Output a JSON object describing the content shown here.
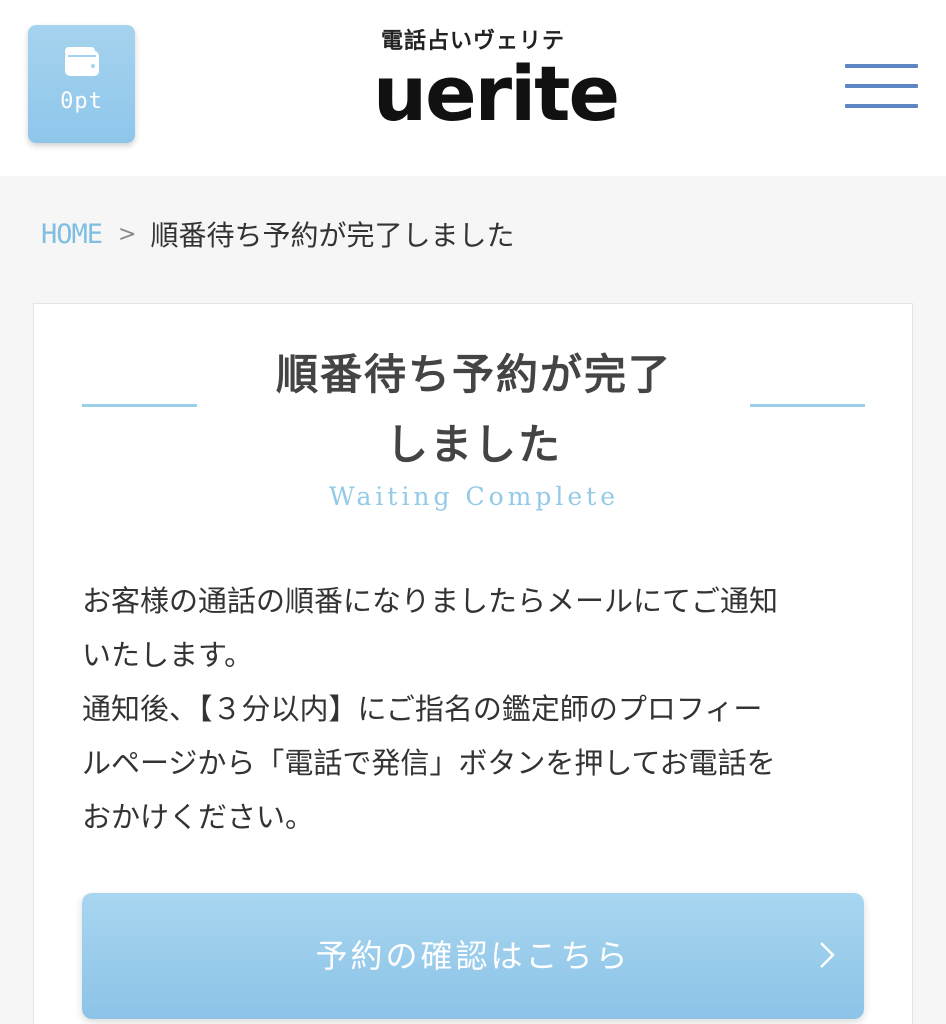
{
  "header": {
    "points_label": "0pt",
    "logo_sub": "電話占いヴェリテ",
    "logo_main": "uerite"
  },
  "breadcrumb": {
    "home": "HOME",
    "separator": ">",
    "current": "順番待ち予約が完了しました"
  },
  "main": {
    "title_line1": "順番待ち予約が完了",
    "title_line2": "しました",
    "subtitle": "Waiting Complete",
    "message": [
      "お客様の通話の順番になりましたらメールにてご通知",
      "いたします。",
      "通知後、【３分以内】にご指名の鑑定師のプロフィー",
      "ルページから「電話で発信」ボタンを押してお電話を",
      "おかけください。"
    ],
    "confirm_button": "予約の確認はこちら"
  },
  "colors": {
    "accent": "#8ec6ea",
    "menu": "#5f86c4",
    "line": "#9acfe8"
  },
  "icons": [
    "wallet-icon",
    "menu-icon",
    "chevron-right-icon"
  ]
}
